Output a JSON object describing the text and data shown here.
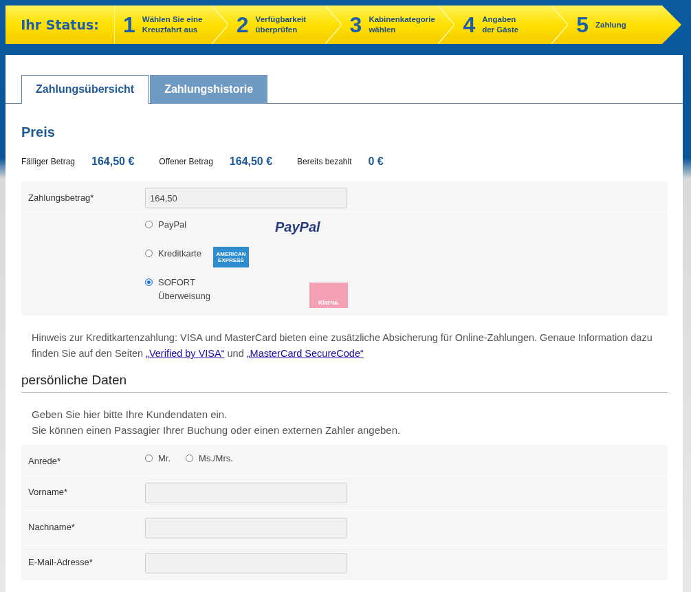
{
  "status_bar": {
    "title": "Ihr Status:",
    "steps": [
      {
        "number": "1",
        "lines": [
          "Wählen Sie eine",
          "Kreuzfahrt aus"
        ]
      },
      {
        "number": "2",
        "lines": [
          "Verfügbarkeit",
          "überprüfen"
        ]
      },
      {
        "number": "3",
        "lines": [
          "Kabinenkategorie",
          "wählen"
        ]
      },
      {
        "number": "4",
        "lines": [
          "Angaben",
          "der Gäste"
        ]
      },
      {
        "number": "5",
        "lines": [
          "Zahlung"
        ]
      }
    ]
  },
  "tabs": [
    {
      "label": "Zahlungsübersicht",
      "selected": true
    },
    {
      "label": "Zahlungshistorie",
      "selected": false
    }
  ],
  "price": {
    "heading": "Preis",
    "amounts": [
      {
        "label": "Fälliger Betrag",
        "value": "164,50 €"
      },
      {
        "label": "Offener Betrag",
        "value": "164,50 €"
      },
      {
        "label": "Bereits bezahlt",
        "value": "0 €"
      }
    ]
  },
  "payment": {
    "amount_label": "Zahlungsbetrag*",
    "amount_value": "164,50",
    "methods": [
      {
        "label": "PayPal",
        "selected": false,
        "kind": "paypal",
        "logo_text": "PayPal"
      },
      {
        "label": "Kreditkarte",
        "selected": false,
        "kind": "amex",
        "logo_text": "AMERICAN EXPRESS"
      },
      {
        "label": "SOFORT Überweisung",
        "selected": true,
        "kind": "klarna",
        "logo_text": "Klarna."
      }
    ]
  },
  "hint": {
    "text_before": "Hinweis zur Kreditkartenzahlung: VISA und MasterCard bieten eine zusätzliche Absicherung für Online-Zahlungen. Genaue Information dazu finden Sie auf den Seiten ",
    "link_1": "„Verified by VISA“",
    "text_middle": " und ",
    "link_2": "„MasterCard SecureCode“"
  },
  "personal": {
    "heading": "persönliche Daten",
    "intro": [
      "Geben Sie hier bitte Ihre Kundendaten ein.",
      "Sie können einen Passagier Ihrer Buchung oder einen externen Zahler angeben."
    ],
    "salutation": {
      "label": "Anrede*",
      "options": [
        {
          "label": "Mr.",
          "selected": false
        },
        {
          "label": "Ms./Mrs.",
          "selected": false
        }
      ]
    },
    "fields": [
      {
        "label": "Vorname*"
      },
      {
        "label": "Nachname*"
      },
      {
        "label": "E-Mail-Adresse*"
      }
    ]
  }
}
